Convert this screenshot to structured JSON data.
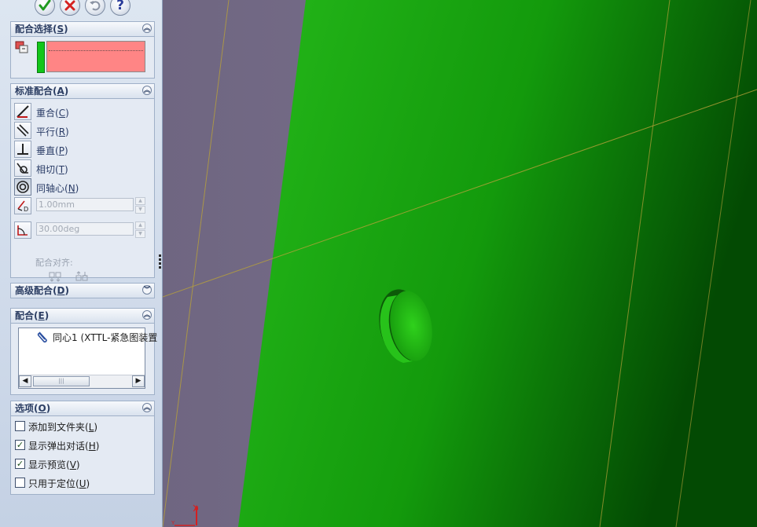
{
  "top_buttons": {
    "ok": "ok-icon",
    "cancel": "cancel-icon",
    "undo": "undo-icon",
    "help": "help-icon"
  },
  "sections": {
    "mate_selections": {
      "title": "配合选择(",
      "shortcut": "S",
      "close": ")"
    },
    "standard_mates": {
      "title": "标准配合(",
      "shortcut": "A",
      "close": ")",
      "items": [
        {
          "label": "重合(",
          "shortcut": "C",
          "close": ")"
        },
        {
          "label": "平行(",
          "shortcut": "R",
          "close": ")"
        },
        {
          "label": "垂直(",
          "shortcut": "P",
          "close": ")"
        },
        {
          "label": "相切(",
          "shortcut": "T",
          "close": ")"
        },
        {
          "label": "同轴心(",
          "shortcut": "N",
          "close": ")"
        }
      ],
      "distance_value": "1.00mm",
      "angle_value": "30.00deg",
      "mate_alignment_label": "配合对齐:"
    },
    "advanced_mates": {
      "title": "高级配合(",
      "shortcut": "D",
      "close": ")"
    },
    "mates": {
      "title": "配合(",
      "shortcut": "E",
      "close": ")",
      "items": [
        {
          "label": "同心1 (XTTL-紧急图装置"
        }
      ]
    },
    "options": {
      "title": "选项(",
      "shortcut": "O",
      "close": ")",
      "items": [
        {
          "label": "添加到文件夹(",
          "shortcut": "L",
          "close": ")",
          "checked": false
        },
        {
          "label": "显示弹出对话(",
          "shortcut": "H",
          "close": ")",
          "checked": true
        },
        {
          "label": "显示预览(",
          "shortcut": "V",
          "close": ")",
          "checked": true
        },
        {
          "label": "只用于定位(",
          "shortcut": "U",
          "close": ")",
          "checked": false
        }
      ]
    }
  },
  "colors": {
    "selection_box": "#ff8585",
    "selection_indicator": "#12c61a",
    "part_green": "#1faa12",
    "background_purple": "#7a6f8e"
  }
}
